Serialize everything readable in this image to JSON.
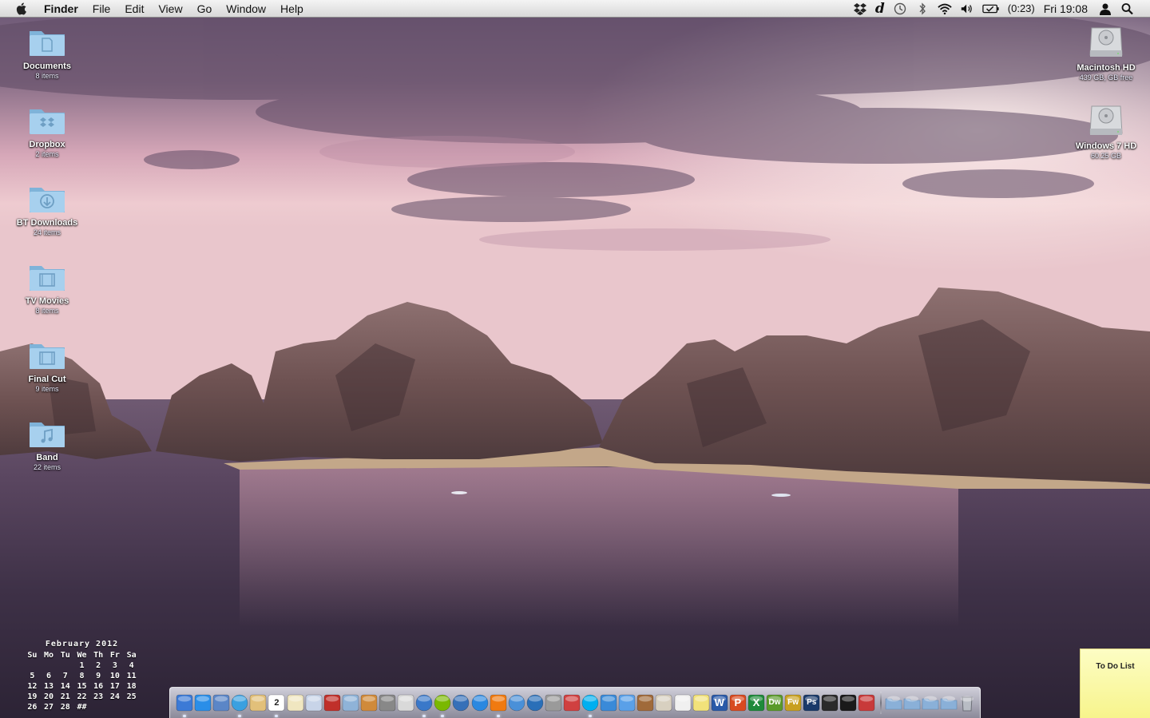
{
  "menubar": {
    "app_name": "Finder",
    "menus": [
      "File",
      "Edit",
      "View",
      "Go",
      "Window",
      "Help"
    ],
    "status": {
      "battery_time": "(0:23)",
      "clock": "Fri 19:08"
    }
  },
  "desktop_left": [
    {
      "name": "Documents",
      "sub": "8 items",
      "icon": "documents-folder-icon"
    },
    {
      "name": "Dropbox",
      "sub": "2 items",
      "icon": "dropbox-folder-icon"
    },
    {
      "name": "BT Downloads",
      "sub": "24 items",
      "icon": "downloads-folder-icon"
    },
    {
      "name": "TV Movies",
      "sub": "8 items",
      "icon": "movies-folder-icon"
    },
    {
      "name": "Final Cut",
      "sub": "9 items",
      "icon": "movies-folder-icon"
    },
    {
      "name": "Band",
      "sub": "22 items",
      "icon": "music-folder-icon"
    }
  ],
  "desktop_right": [
    {
      "name": "Macintosh HD",
      "sub": "439 GB,   GB free",
      "icon": "hard-drive-icon"
    },
    {
      "name": "Windows 7 HD",
      "sub": "60.25 GB",
      "icon": "hard-drive-icon"
    }
  ],
  "calendar": {
    "month": "February 2012",
    "weekdays": [
      "Su",
      "Mo",
      "Tu",
      "We",
      "Th",
      "Fr",
      "Sa"
    ],
    "weeks": [
      [
        "",
        "",
        "",
        "1",
        "2",
        "3",
        "4"
      ],
      [
        "5",
        "6",
        "7",
        "8",
        "9",
        "10",
        "11"
      ],
      [
        "12",
        "13",
        "14",
        "15",
        "16",
        "17",
        "18"
      ],
      [
        "19",
        "20",
        "21",
        "22",
        "23",
        "24",
        "25"
      ],
      [
        "26",
        "27",
        "28",
        "##",
        "",
        "",
        ""
      ]
    ]
  },
  "sticky_note": {
    "title": "To Do List"
  },
  "dock": {
    "items": [
      {
        "name": "finder",
        "color": "#3c7ad6",
        "running": true
      },
      {
        "name": "app-store",
        "color": "#2a8ee8",
        "running": false
      },
      {
        "name": "preview",
        "color": "#5b86c7",
        "running": false
      },
      {
        "name": "safari",
        "color": "#3aa0e0",
        "running": true
      },
      {
        "name": "notes",
        "color": "#e2c07a",
        "running": false
      },
      {
        "name": "ical",
        "color": "#ffffff",
        "running": true,
        "label": "2"
      },
      {
        "name": "textedit",
        "color": "#f0e6c0",
        "running": false
      },
      {
        "name": "mail",
        "color": "#c8d4e8",
        "running": false
      },
      {
        "name": "photo-booth",
        "color": "#c0302a",
        "running": false
      },
      {
        "name": "iphoto",
        "color": "#8fb3d8",
        "running": false
      },
      {
        "name": "garageband",
        "color": "#d08a3a",
        "running": false
      },
      {
        "name": "utility-knife",
        "color": "#888888",
        "running": false
      },
      {
        "name": "imovie-star",
        "color": "#d9d9d9",
        "running": false
      },
      {
        "name": "itunes",
        "color": "#3a78c9",
        "running": true
      },
      {
        "name": "spotify",
        "color": "#7ab800",
        "running": true
      },
      {
        "name": "network",
        "color": "#3670b8",
        "running": false
      },
      {
        "name": "quicktime",
        "color": "#2a88e0",
        "running": false
      },
      {
        "name": "vlc",
        "color": "#f07a10",
        "running": true
      },
      {
        "name": "ichat",
        "color": "#4a90d8",
        "running": false
      },
      {
        "name": "skype-web",
        "color": "#2a6fb8",
        "running": false
      },
      {
        "name": "system-preferences",
        "color": "#9a9a9a",
        "running": false
      },
      {
        "name": "tools",
        "color": "#d04040",
        "running": false
      },
      {
        "name": "skype",
        "color": "#00aff0",
        "running": true
      },
      {
        "name": "people",
        "color": "#3a8ad8",
        "running": false
      },
      {
        "name": "messages",
        "color": "#5aa0e8",
        "running": false
      },
      {
        "name": "pets",
        "color": "#a06a3a",
        "running": false
      },
      {
        "name": "dictionary",
        "color": "#d8d0c0",
        "running": false
      },
      {
        "name": "papers",
        "color": "#f0f0f0",
        "running": false
      },
      {
        "name": "stickies",
        "color": "#f2e27a",
        "running": false
      },
      {
        "name": "word",
        "color": "#2a5aa8",
        "running": false,
        "label": "W"
      },
      {
        "name": "powerpoint",
        "color": "#d84a20",
        "running": false,
        "label": "P"
      },
      {
        "name": "excel",
        "color": "#1e8a3a",
        "running": false,
        "label": "X"
      },
      {
        "name": "dreamweaver",
        "color": "#5a9a2a",
        "running": false,
        "label": "Dw"
      },
      {
        "name": "fireworks",
        "color": "#c8a020",
        "running": false,
        "label": "Fw"
      },
      {
        "name": "photoshop",
        "color": "#1a3a6a",
        "running": false,
        "label": "Ps"
      },
      {
        "name": "activity-monitor",
        "color": "#2a2a2a",
        "running": false
      },
      {
        "name": "terminal",
        "color": "#1a1a1a",
        "running": false
      },
      {
        "name": "flag-app",
        "color": "#c83a3a",
        "running": false
      }
    ],
    "stacks": [
      {
        "name": "applications-stack",
        "color": "#8ab0d8"
      },
      {
        "name": "documents-stack",
        "color": "#8ab0d8"
      },
      {
        "name": "downloads-stack",
        "color": "#8ab0d8"
      },
      {
        "name": "pictures-stack",
        "color": "#8ab0d8"
      },
      {
        "name": "trash",
        "color": "#b8bcc4"
      }
    ]
  }
}
